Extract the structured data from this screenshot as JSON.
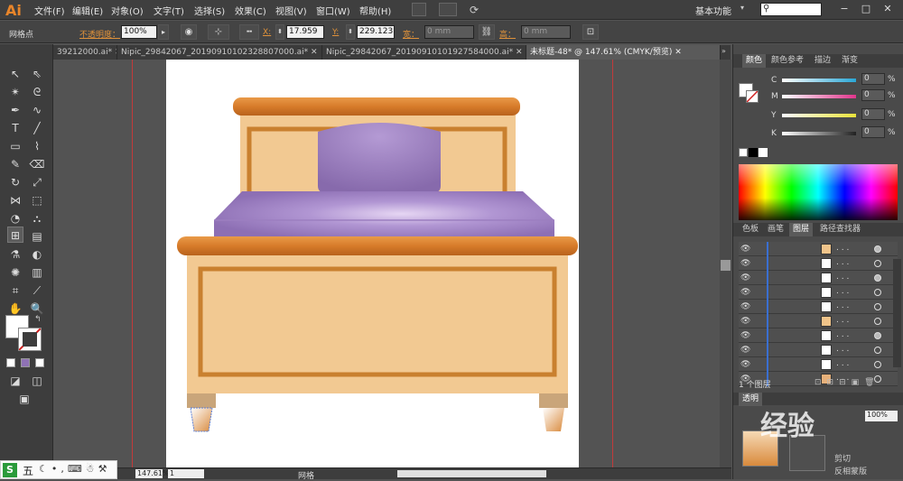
{
  "app": {
    "logo": "Ai"
  },
  "menu": [
    "文件(F)",
    "编辑(E)",
    "对象(O)",
    "文字(T)",
    "选择(S)",
    "效果(C)",
    "视图(V)",
    "窗口(W)",
    "帮助(H)"
  ],
  "workspace": "基本功能",
  "control": {
    "mode_label": "网格点",
    "opacity_label": "不透明度：",
    "opacity_value": "100%",
    "x_label": "X:",
    "x_value": "17.959",
    "y_label": "Y:",
    "y_value": "229.123",
    "w_label": "宽：",
    "w_value": "0 mm",
    "h_label": "高：",
    "h_value": "0 mm"
  },
  "tabs": [
    {
      "label": "39212000.ai*",
      "close": "✕"
    },
    {
      "label": "Nipic_29842067_20190910102328807000.ai*",
      "close": "✕"
    },
    {
      "label": "Nipic_29842067_20190910101927584000.ai*",
      "close": "✕"
    },
    {
      "label": "未标题-48* @ 147.61% (CMYK/预览)",
      "close": "✕"
    }
  ],
  "color_panel": {
    "tabs": [
      "颜色",
      "颜色参考",
      "描边",
      "渐变"
    ],
    "channels": [
      {
        "label": "C",
        "value": "0",
        "unit": "%",
        "color": "#2aa7d6"
      },
      {
        "label": "M",
        "value": "0",
        "unit": "%",
        "color": "#e0358c"
      },
      {
        "label": "Y",
        "value": "0",
        "unit": "%",
        "color": "#e8e23a"
      },
      {
        "label": "K",
        "value": "0",
        "unit": "%",
        "color": "#222222"
      }
    ]
  },
  "layers_panel": {
    "tabs": [
      "色板",
      "画笔",
      "图层",
      "路径查找器"
    ],
    "row_dots": ". . .",
    "row_eye": "👁",
    "footer": "1 个图层",
    "rows": [
      {
        "thumb": "#f0c48a",
        "target": "filled"
      },
      {
        "thumb": "#ffffff",
        "target": "hollow"
      },
      {
        "thumb": "#ffffff",
        "target": "filled"
      },
      {
        "thumb": "#ffffff",
        "target": "hollow"
      },
      {
        "thumb": "#ffffff",
        "target": "hollow"
      },
      {
        "thumb": "#f0c48a",
        "target": "hollow"
      },
      {
        "thumb": "#ffffff",
        "target": "filled"
      },
      {
        "thumb": "#ffffff",
        "target": "hollow"
      },
      {
        "thumb": "#ffffff",
        "target": "hollow"
      },
      {
        "thumb": "#e6b07a",
        "target": "hollow"
      }
    ]
  },
  "transparency_panel": {
    "tab": "透明",
    "opacity": "100%",
    "clip_label": "剪切",
    "invert_label": "反相蒙版"
  },
  "watermark": "经验",
  "status": {
    "zoom": "147.61%",
    "page": "1",
    "label": "网格"
  },
  "ime": {
    "label": "五"
  },
  "colors": {
    "bed_wood": "#f2c992",
    "bed_trim": "#c9802f",
    "bed_rail": "#d9822b",
    "mattress": "#9c7fc0",
    "pillow": "#8f72b5"
  }
}
